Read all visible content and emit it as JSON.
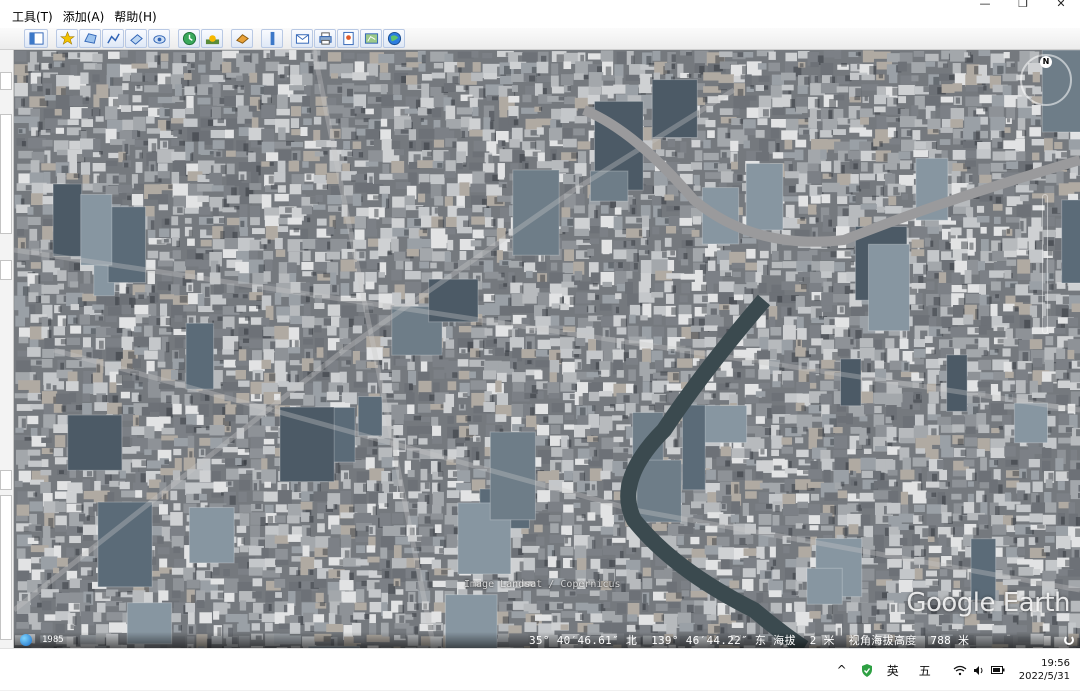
{
  "menu": [
    {
      "label": "工具(T)"
    },
    {
      "label": "添加(A)"
    },
    {
      "label": "帮助(H)"
    }
  ],
  "window_controls": {
    "minimize": "—",
    "restore": "❐",
    "close": "✕"
  },
  "toolbar": {
    "icons": [
      "sidebar-toggle-icon",
      "placemark-icon",
      "polygon-icon",
      "path-icon",
      "image-overlay-icon",
      "tour-icon",
      "historical-imagery-icon",
      "sunlight-icon",
      "planets-icon",
      "ruler-icon",
      "email-icon",
      "print-icon",
      "save-image-icon",
      "map-view-icon",
      "globe-icon"
    ]
  },
  "map": {
    "watermark": "Google Earth",
    "imagery_credit": "Image Landsat / Copernicus",
    "year": "1985",
    "north_label": "N",
    "status": {
      "lat": "35° 40′46.61″ 北",
      "lon": "139° 46′44.22″ 东",
      "elev_label": "海拔",
      "elev": "2 米",
      "eye_label": "视角海拔高度",
      "eye": "788 米"
    }
  },
  "taskbar": {
    "tray_arrow": "^",
    "ime_lang": "英",
    "ime_mode": "五",
    "time": "19:56",
    "date": "2022/5/31"
  },
  "colors": {
    "accent": "#3c78c8",
    "map_base": "#6f7378"
  }
}
